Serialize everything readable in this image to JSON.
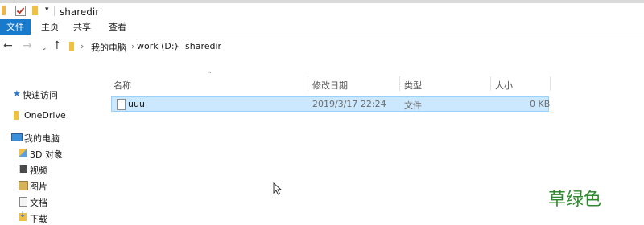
{
  "window": {
    "title": "sharedir"
  },
  "ribbon": {
    "tabs": [
      "文件",
      "主页",
      "共享",
      "查看"
    ]
  },
  "address": {
    "breadcrumbs": [
      "我的电脑",
      "work (D:)",
      "sharedir"
    ],
    "separator": "›",
    "nav": {
      "back": "←",
      "forward": "→",
      "recent": "⌄",
      "up": "↑"
    }
  },
  "sidebar": {
    "items": [
      {
        "label": "快速访问",
        "icon": "star-icon"
      },
      {
        "label": "OneDrive",
        "icon": "folder-icon"
      },
      {
        "label": "我的电脑",
        "icon": "computer-icon"
      },
      {
        "label": "3D 对象",
        "icon": "3d-objects-icon"
      },
      {
        "label": "视频",
        "icon": "video-icon"
      },
      {
        "label": "图片",
        "icon": "pictures-icon"
      },
      {
        "label": "文档",
        "icon": "document-icon"
      },
      {
        "label": "下载",
        "icon": "download-icon"
      }
    ]
  },
  "file_list": {
    "sort_indicator": "⌃",
    "columns": [
      "名称",
      "修改日期",
      "类型",
      "大小"
    ],
    "rows": [
      {
        "name": "uuu",
        "modified": "2019/3/17 22:24",
        "type": "文件",
        "size": "0 KB",
        "selected": true
      }
    ]
  },
  "watermark": {
    "text": "草绿色"
  },
  "colors": {
    "file_tab": "#1979ca",
    "selection": "#cce8ff",
    "watermark": "#2e8b30"
  }
}
